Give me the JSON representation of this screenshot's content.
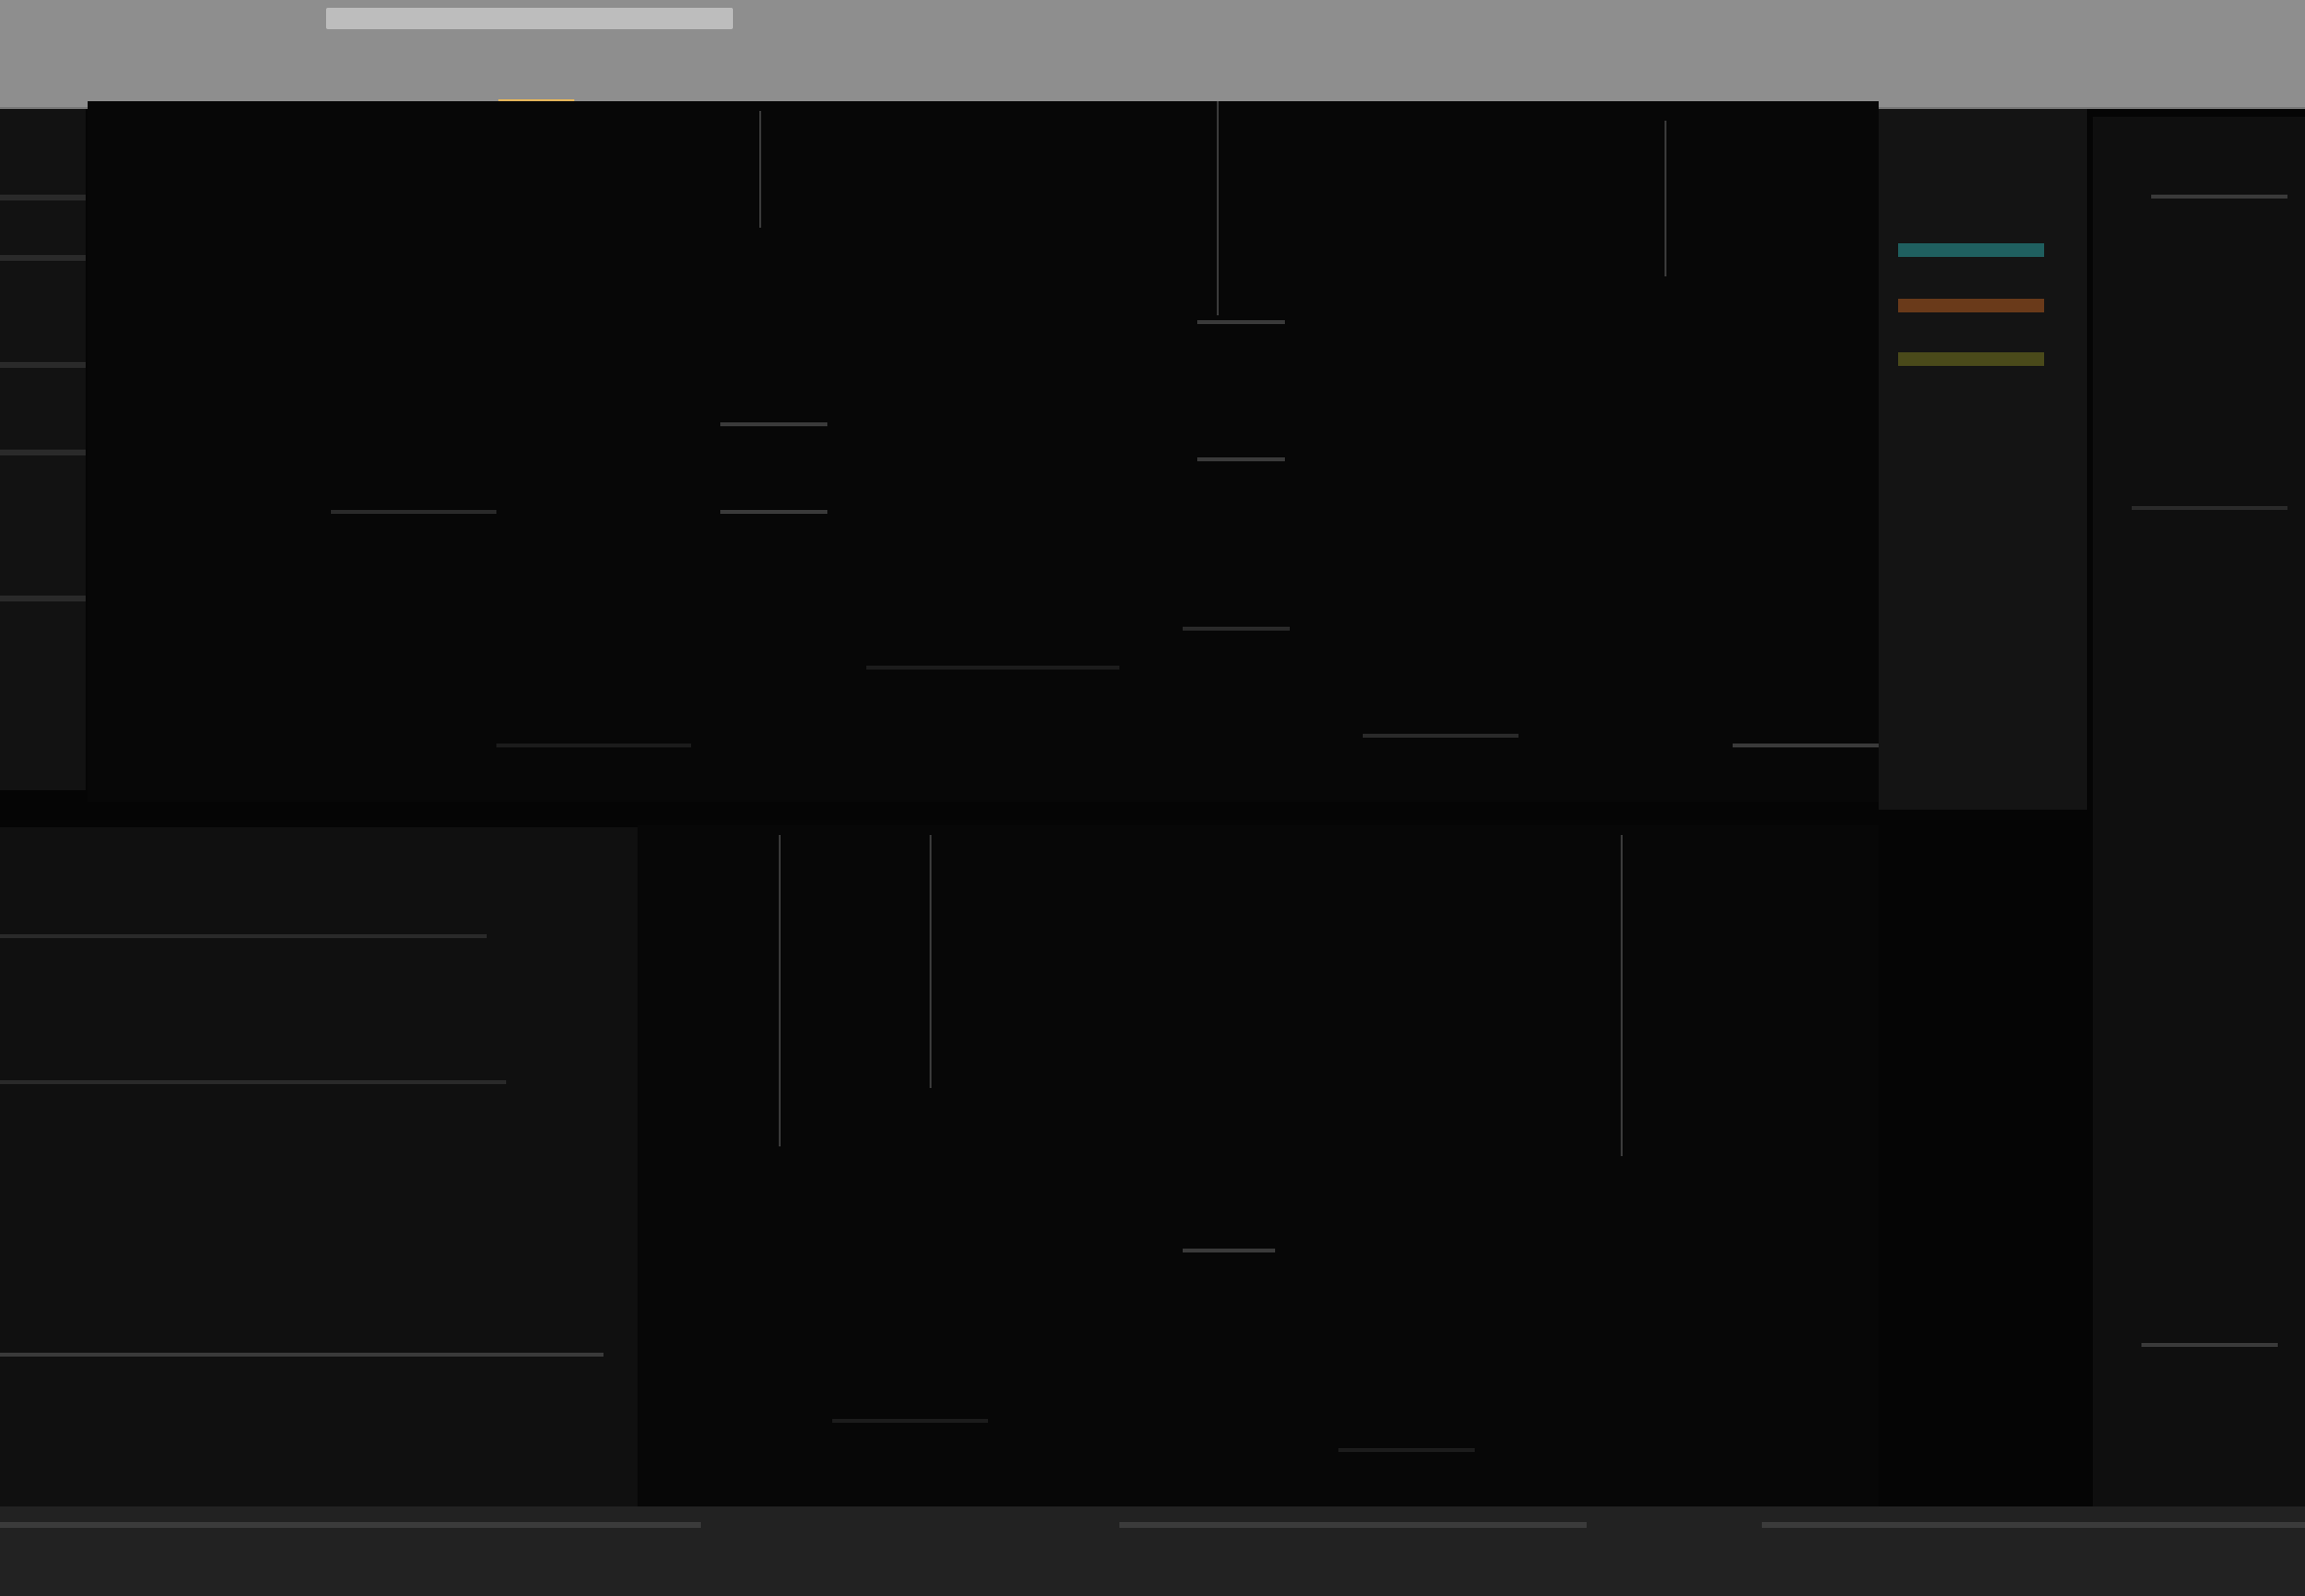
{
  "window": {
    "title": "",
    "tab_label": ""
  },
  "colors": {
    "accent": "#e3b45a",
    "bg_dark": "#050505",
    "titlebar": "#8e8e8e"
  },
  "inspector": {
    "swatches": [
      {
        "name": "teal",
        "color": "#1f5f5f"
      },
      {
        "name": "orange",
        "color": "#6a3a1a"
      },
      {
        "name": "olive",
        "color": "#4a4a1a"
      }
    ]
  }
}
